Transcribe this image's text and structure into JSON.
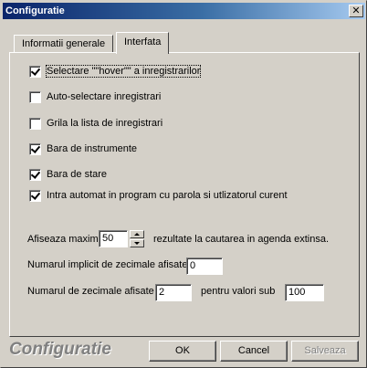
{
  "window": {
    "title": "Configuratie",
    "close_glyph": "✕"
  },
  "tabs": [
    {
      "label": "Informatii generale",
      "active": false
    },
    {
      "label": "Interfata",
      "active": true
    }
  ],
  "options": [
    {
      "label": "Selectare \"\"hover\"\" a inregistrarilor",
      "checked": true
    },
    {
      "label": "Auto-selectare inregistrari",
      "checked": false
    },
    {
      "label": "Grila la lista de inregistrari",
      "checked": false
    },
    {
      "label": "Bara de instrumente",
      "checked": true
    },
    {
      "label": "Bara de stare",
      "checked": true
    },
    {
      "label": "Intra automat in program cu parola si utlizatorul curent",
      "checked": true
    }
  ],
  "max_results": {
    "prefix": "Afiseaza maxim",
    "value": "50",
    "suffix": "rezultate la cautarea in agenda extinsa."
  },
  "default_decimals": {
    "label": "Numarul implicit de zecimale afisate",
    "value": "0"
  },
  "decimals": {
    "label": "Numarul de zecimale afisate",
    "value": "2",
    "middle": "pentru valori sub",
    "threshold": "100"
  },
  "footer": {
    "title": "Configuratie"
  },
  "buttons": {
    "ok": "OK",
    "cancel": "Cancel",
    "save": "Salveaza"
  }
}
